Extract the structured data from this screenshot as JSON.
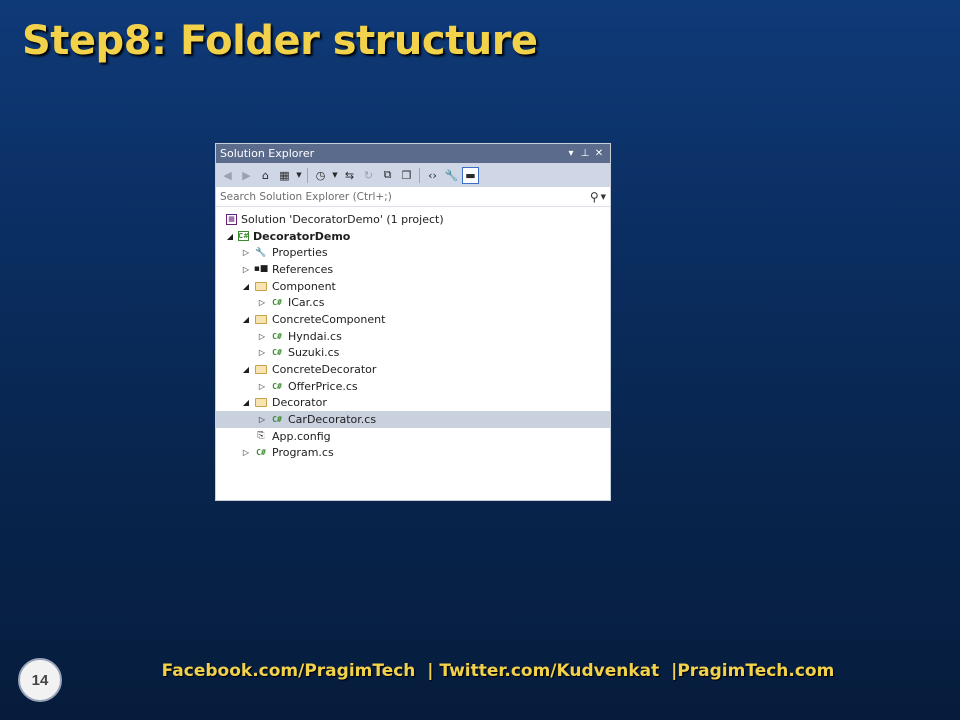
{
  "slide": {
    "title": "Step8: Folder structure",
    "page_number": "14",
    "footer": "Facebook.com/PragimTech  | Twitter.com/Kudvenkat  |PragimTech.com"
  },
  "colors": {
    "title": "#f2d24a",
    "background_top": "#0f3a78",
    "background_bottom": "#061c3c",
    "titlebar": "#5b6b8c",
    "selection": "#c9d0de"
  },
  "solution_explorer": {
    "title": "Solution Explorer",
    "window_buttons": [
      "▾",
      "⊥",
      "✕"
    ],
    "toolbar_icons": [
      "back-icon",
      "forward-icon",
      "home-icon",
      "switch-views-icon",
      "pending-changes-icon",
      "sync-icon",
      "refresh-icon",
      "collapse-all-icon",
      "show-all-files-icon",
      "view-code-icon",
      "properties-icon",
      "preview-icon"
    ],
    "search_placeholder": "Search Solution Explorer (Ctrl+;)",
    "tree": [
      {
        "label": "Solution 'DecoratorDemo' (1 project)",
        "icon": "solution-icon",
        "expander": "",
        "level": 0
      },
      {
        "label": "DecoratorDemo",
        "icon": "csharp-project-icon",
        "expander": "expanded",
        "level": 0,
        "bold": true
      },
      {
        "label": "Properties",
        "icon": "wrench-icon",
        "expander": "collapsed",
        "level": 1
      },
      {
        "label": "References",
        "icon": "references-icon",
        "expander": "collapsed",
        "level": 1
      },
      {
        "label": "Component",
        "icon": "folder-icon",
        "expander": "expanded",
        "level": 1
      },
      {
        "label": "ICar.cs",
        "icon": "csharp-file-icon",
        "expander": "collapsed",
        "level": 2
      },
      {
        "label": "ConcreteComponent",
        "icon": "folder-icon",
        "expander": "expanded",
        "level": 1
      },
      {
        "label": "Hyndai.cs",
        "icon": "csharp-file-icon",
        "expander": "collapsed",
        "level": 2
      },
      {
        "label": "Suzuki.cs",
        "icon": "csharp-file-icon",
        "expander": "collapsed",
        "level": 2
      },
      {
        "label": "ConcreteDecorator",
        "icon": "folder-icon",
        "expander": "expanded",
        "level": 1
      },
      {
        "label": "OfferPrice.cs",
        "icon": "csharp-file-icon",
        "expander": "collapsed",
        "level": 2
      },
      {
        "label": "Decorator",
        "icon": "folder-icon",
        "expander": "expanded",
        "level": 1
      },
      {
        "label": "CarDecorator.cs",
        "icon": "csharp-file-icon",
        "expander": "collapsed",
        "level": 2,
        "selected": true
      },
      {
        "label": "App.config",
        "icon": "config-file-icon",
        "expander": "",
        "level": 1
      },
      {
        "label": "Program.cs",
        "icon": "csharp-file-icon",
        "expander": "collapsed",
        "level": 1
      }
    ]
  }
}
